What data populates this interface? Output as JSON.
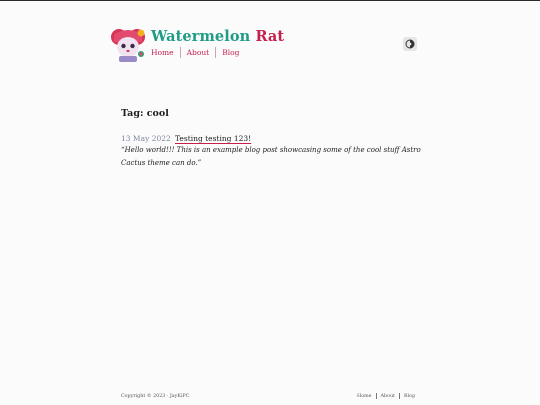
{
  "site": {
    "title_part1": "Watermelon",
    "title_part2": "Rat"
  },
  "nav": {
    "items": [
      "Home",
      "About",
      "Blog"
    ]
  },
  "main": {
    "page_title": "Tag: cool",
    "posts": [
      {
        "date": "13 May 2022",
        "title": "Testing testing 123!",
        "description": "“Hello world!!! This is an example blog post showcasing some of the cool stuff Astro Cactus theme can do.”"
      }
    ]
  },
  "footer": {
    "copyright": "Copyright © 2023 · JayKiPC",
    "nav": [
      "Home",
      "About",
      "Blog"
    ]
  },
  "icons": {
    "theme_toggle": "theme-toggle-icon",
    "logo": "watermelon-rat-logo"
  },
  "colors": {
    "title_primary": "#1f9c86",
    "title_accent": "#c5204d",
    "link": "#c5204d",
    "date": "#7d8aa0",
    "background": "#fbfbfb"
  }
}
